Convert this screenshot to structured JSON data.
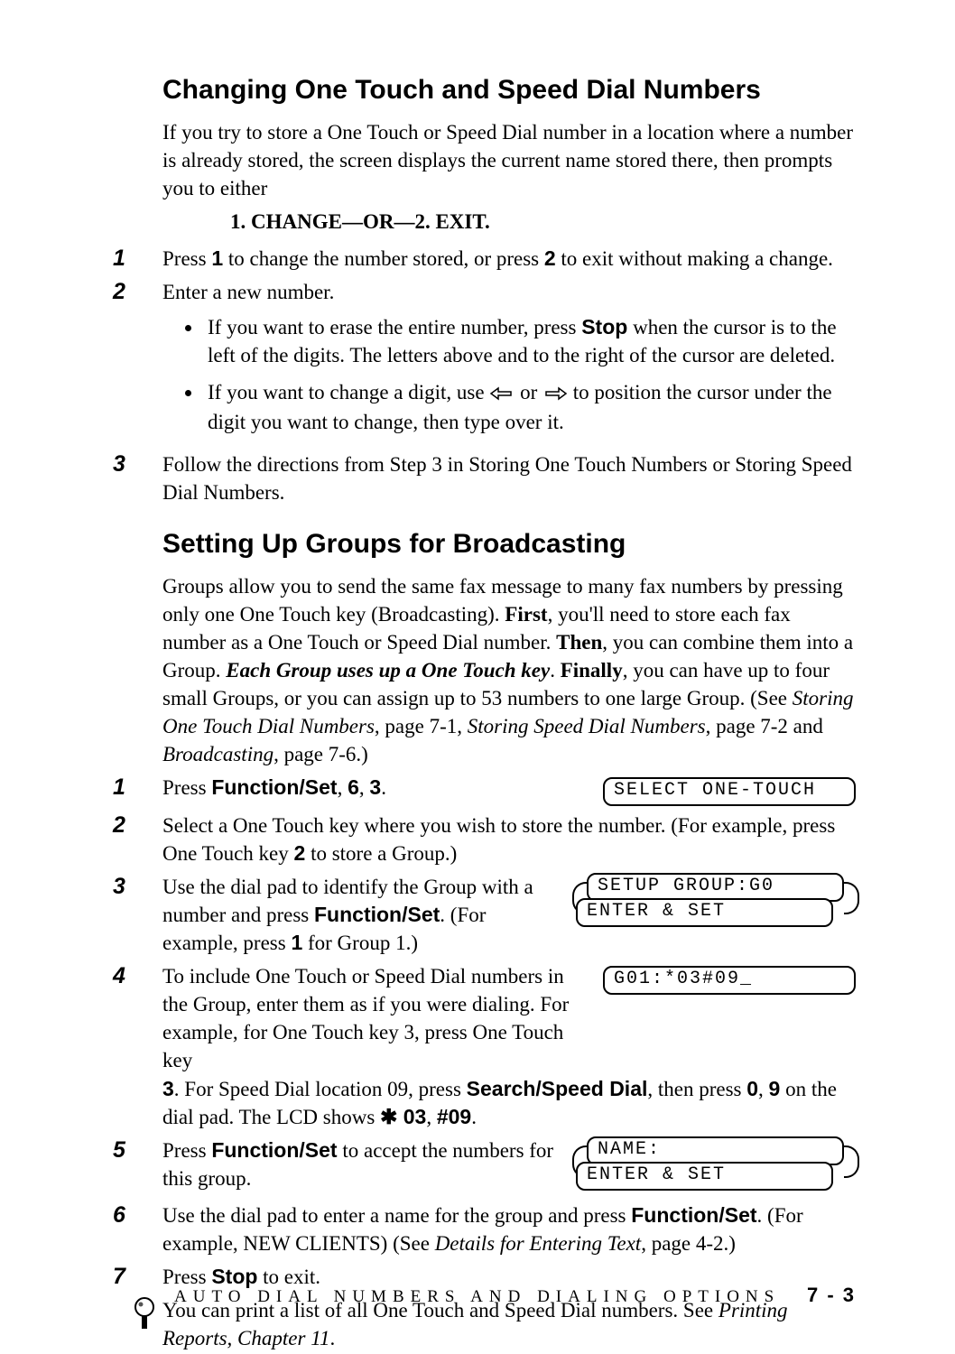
{
  "section1": {
    "heading": "Changing One Touch and Speed Dial Numbers",
    "intro": "If you try to store a One Touch or Speed Dial number in a location where a number is already stored, the screen displays the current name stored there, then prompts you to either",
    "prompt": "1. CHANGE—OR—2. EXIT.",
    "steps": [
      {
        "n": "1",
        "pre": "Press ",
        "b1": "1",
        "mid": " to change the number stored, or press ",
        "b2": "2",
        "post": " to exit without making a change."
      },
      {
        "n": "2",
        "text": "Enter a new number.",
        "bullets": [
          {
            "pre": "If you want to erase the entire number, press ",
            "bold": "Stop",
            "post": " when the cursor is to the left of the digits. The letters above and to the right of the cursor are deleted."
          },
          {
            "pre": "If you want to change a digit, use ",
            "mid": " or ",
            "post": " to position the cursor under the digit you want to change, then type over it."
          }
        ]
      },
      {
        "n": "3",
        "text": "Follow the directions from Step 3 in Storing One Touch Numbers or Storing Speed Dial Numbers."
      }
    ]
  },
  "section2": {
    "heading": "Setting Up Groups for Broadcasting",
    "intro_a": "Groups allow you to send the same fax message to many fax numbers by pressing only one One Touch key (Broadcasting).  ",
    "intro_first": "First",
    "intro_b": ", you'll need to store each fax number as a One Touch or Speed Dial number.  ",
    "intro_then": "Then",
    "intro_c": ", you can combine them into a Group.  ",
    "intro_each": "Each Group uses up a One Touch key",
    "intro_d": ".  ",
    "intro_finally": "Finally",
    "intro_e": ", you can have up to four small Groups, or you can assign up to 53 numbers to one large Group. (See ",
    "cite1": "Storing One Touch Dial Numbers",
    "intro_f": ", page 7-1, ",
    "cite2": "Storing Speed Dial Numbers",
    "intro_g": ", page 7-2 and ",
    "cite3": "Broadcasting",
    "intro_h": ", page 7-6.)",
    "steps": {
      "1": {
        "n": "1",
        "pre": "Press ",
        "b": "Function/Set",
        "mid": ", ",
        "b2": "6",
        "mid2": ", ",
        "b3": "3",
        "post": "."
      },
      "2": {
        "n": "2",
        "pre": "Select a One Touch key where you wish to store the number.  (For example, press One Touch key ",
        "b": "2",
        "post": " to store a Group.)"
      },
      "3": {
        "n": "3",
        "pre": "Use the dial pad to identify the Group with a number and press ",
        "b": "Function/Set",
        "post": ". (For example, press ",
        "b2": "1",
        "post2": " for Group 1.)"
      },
      "4": {
        "n": "4",
        "a": "To include One Touch or Speed Dial numbers in the Group, enter them as if you were dialing. For example, for One Touch key 3, press One Touch key ",
        "b1": "3",
        "b": ". For Speed Dial location 09, press ",
        "b2": "Search/Speed Dial",
        "c": ", then press ",
        "b3": "0",
        "d": ", ",
        "b4": "9",
        "e": " on the dial pad. The LCD shows ",
        "sym1": "✱",
        "s1": " 03",
        "s2": ", ",
        "s3": "#09",
        "f": "."
      },
      "5": {
        "n": "5",
        "pre": "Press ",
        "b": "Function/Set",
        "post": " to accept the numbers for this group."
      },
      "6": {
        "n": "6",
        "pre": "Use the dial pad to enter a name for the group and press ",
        "b": "Function/Set",
        "post": ". (For example, NEW CLIENTS) (See ",
        "cite": "Details for Entering Text",
        "post2": ", page 4-2.)"
      },
      "7": {
        "n": "7",
        "pre": "Press ",
        "b": "Stop",
        "post": " to exit."
      }
    },
    "lcd": {
      "select": "SELECT ONE-TOUCH",
      "setup": "SETUP GROUP:G0",
      "enter1": "ENTER & SET",
      "g01": "G01:*03#09_",
      "name": "NAME:",
      "enter2": "ENTER & SET"
    },
    "tip_a": "You can print a list of all One Touch and Speed Dial numbers.  See ",
    "tip_cite": "Printing Reports, Chapter 11",
    "tip_b": "."
  },
  "footer": {
    "text": "AUTO  DIAL  NUMBERS  AND  DIALING  OPTIONS",
    "page": "7 - 3"
  }
}
